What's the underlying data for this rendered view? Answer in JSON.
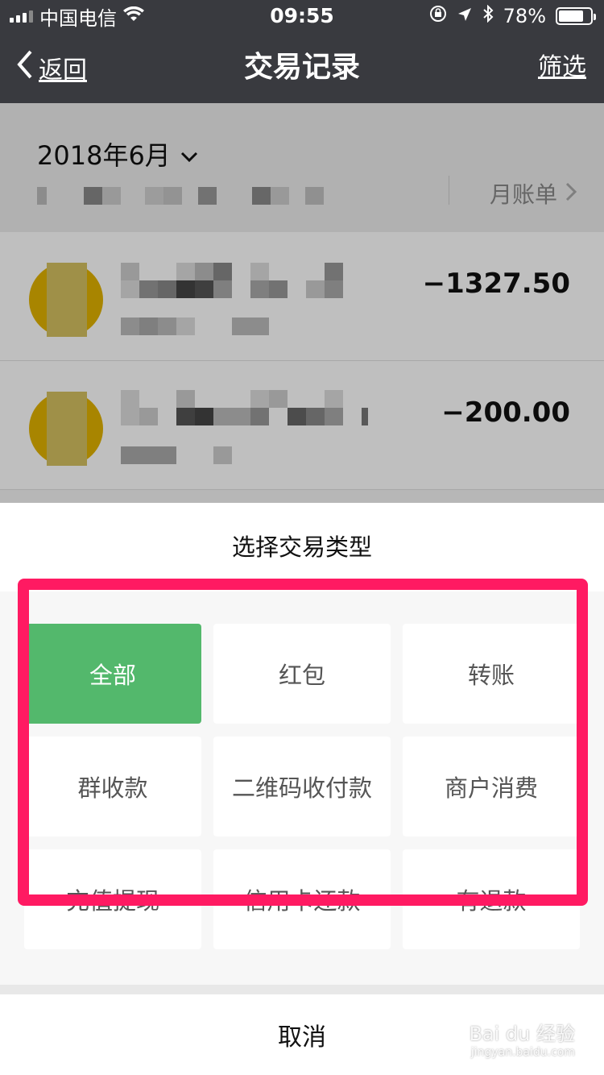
{
  "status_bar": {
    "carrier": "中国电信",
    "time": "09:55",
    "battery": "78%",
    "battery_level": 0.78
  },
  "nav": {
    "back_label": "返回",
    "title": "交易记录",
    "filter_label": "筛选"
  },
  "list": {
    "month": "2018年6月",
    "monthly_bill_label": "月账单",
    "transactions": [
      {
        "amount": "−1327.50"
      },
      {
        "amount": "−200.00"
      }
    ]
  },
  "sheet": {
    "title": "选择交易类型",
    "options": [
      {
        "label": "全部",
        "selected": true
      },
      {
        "label": "红包",
        "selected": false
      },
      {
        "label": "转账",
        "selected": false
      },
      {
        "label": "群收款",
        "selected": false
      },
      {
        "label": "二维码收付款",
        "selected": false
      },
      {
        "label": "商户消费",
        "selected": false
      },
      {
        "label": "充值提现",
        "selected": false
      },
      {
        "label": "信用卡还款",
        "selected": false
      },
      {
        "label": "有退款",
        "selected": false
      }
    ],
    "cancel_label": "取消"
  },
  "watermark": {
    "brand": "Bai du 经验",
    "url": "jingyan.baidu.com"
  },
  "colors": {
    "nav_bg": "#393a3f",
    "selected_green": "#53b86c",
    "highlight_pink": "#ff1a62"
  }
}
